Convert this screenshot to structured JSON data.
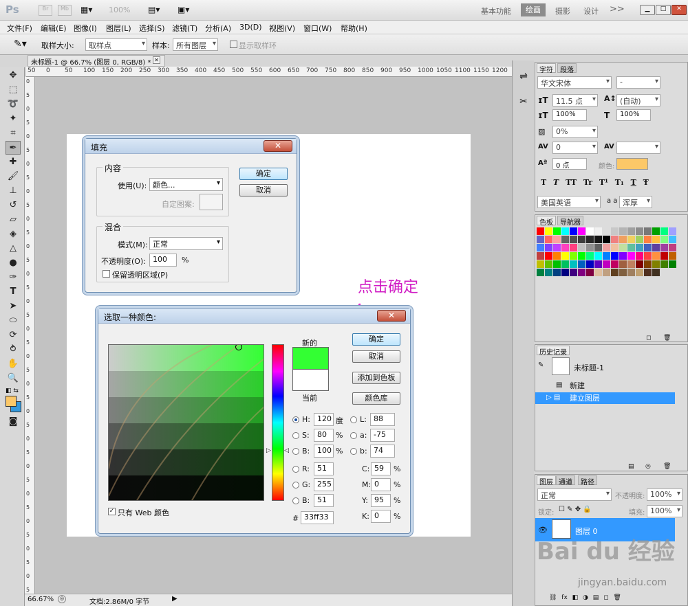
{
  "titlebar": {
    "app_logo": "Ps",
    "zoom": "100%",
    "workspaces": [
      "基本功能",
      "绘画",
      "摄影",
      "设计"
    ],
    "more": ">>",
    "win_min": "▁",
    "win_max": "□",
    "win_close": "✕"
  },
  "menu": [
    "文件(F)",
    "编辑(E)",
    "图像(I)",
    "图层(L)",
    "选择(S)",
    "滤镜(T)",
    "分析(A)",
    "3D(D)",
    "视图(V)",
    "窗口(W)",
    "帮助(H)"
  ],
  "options": {
    "sample_size_label": "取样大小:",
    "sample_size_value": "取样点",
    "sample_label": "样本:",
    "sample_value": "所有图层",
    "show_ring": "显示取样环"
  },
  "document": {
    "tab_title": "未标题-1 @ 66.7% (图层 0, RGB/8) *",
    "tab_close": "✕",
    "ruler_h": [
      "50",
      "0",
      "50",
      "100",
      "150",
      "200",
      "250",
      "300",
      "350",
      "400",
      "450",
      "500",
      "550",
      "600",
      "650",
      "700",
      "750",
      "800",
      "850",
      "900",
      "950",
      "1000",
      "1050",
      "1100",
      "1150",
      "1200"
    ],
    "ruler_v": [
      "0",
      "5",
      "0",
      "5",
      "0",
      "5",
      "0",
      "5",
      "0",
      "5",
      "0",
      "5",
      "0",
      "5",
      "0",
      "5",
      "0",
      "5",
      "0",
      "5",
      "0",
      "5",
      "0",
      "5",
      "0",
      "5",
      "0",
      "5",
      "0",
      "5",
      "0",
      "5",
      "0",
      "5",
      "0",
      "5",
      "0",
      "5"
    ]
  },
  "status": {
    "zoom": "66.67%",
    "doc_size": "文档:2.86M/0 字节"
  },
  "fill_dialog": {
    "title": "填充",
    "content_group": "内容",
    "use_label": "使用(U):",
    "use_value": "颜色...",
    "pattern_label": "自定图案:",
    "blend_group": "混合",
    "mode_label": "模式(M):",
    "mode_value": "正常",
    "opacity_label": "不透明度(O):",
    "opacity_value": "100",
    "opacity_unit": "%",
    "preserve_label": "保留透明区域(P)",
    "ok": "确定",
    "cancel": "取消"
  },
  "picker_dialog": {
    "title": "选取一种颜色:",
    "new_label": "新的",
    "current_label": "当前",
    "ok": "确定",
    "cancel": "取消",
    "add_swatch": "添加到色板",
    "libraries": "颜色库",
    "web_only": "只有 Web 颜色",
    "new_color": "#33ff33",
    "current_color": "#ffffff",
    "fields": {
      "H": "120",
      "H_unit": "度",
      "S": "80",
      "S_unit": "%",
      "B": "100",
      "B_unit": "%",
      "R": "51",
      "G": "255",
      "Bv": "51",
      "L": "88",
      "a": "-75",
      "b": "74",
      "C": "59",
      "M": "0",
      "Y": "95",
      "K": "0",
      "pct": "%",
      "hex": "33ff33",
      "hash": "#"
    },
    "labels": {
      "H": "H:",
      "S": "S:",
      "B": "B:",
      "R": "R:",
      "G": "G:",
      "Bv": "B:",
      "L": "L:",
      "a": "a:",
      "b": "b:",
      "C": "C:",
      "M": "M:",
      "Y": "Y:",
      "K": "K:"
    }
  },
  "annotation": "点击确定",
  "char_panel": {
    "tab1": "字符",
    "tab2": "段落",
    "font": "华文宋体",
    "style": "-",
    "size": "11.5 点",
    "leading": "(自动)",
    "vscale": "100%",
    "hscale": "100%",
    "tracking_pct": "0%",
    "kerning": "0",
    "baseline": "0 点",
    "color_label": "颜色:",
    "color": "#fcc868",
    "language": "美国英语",
    "aa_label": "a a",
    "aa_value": "浑厚",
    "styles": [
      "T",
      "T",
      "TT",
      "Tr",
      "T¹",
      "T₁",
      "T",
      "Ŧ"
    ]
  },
  "swatches_panel": {
    "tab1": "色板",
    "tab2": "导航器",
    "colors": [
      "#ff0000",
      "#ffff00",
      "#00ff00",
      "#00ffff",
      "#0000ff",
      "#ff00ff",
      "#ffffff",
      "#f0f0f0",
      "#dcdcdc",
      "#c8c8c8",
      "#b4b4b4",
      "#a0a0a0",
      "#8c8c8c",
      "#787878",
      "#00a000",
      "#00ff80",
      "#a0a0ff",
      "#6464c8",
      "#ff6464",
      "#ffa0a0",
      "#646464",
      "#505050",
      "#3c3c3c",
      "#282828",
      "#141414",
      "#000000",
      "#f08080",
      "#f0a060",
      "#f0d060",
      "#a0d060",
      "#ff8040",
      "#ffc040",
      "#80ff80",
      "#40c0ff",
      "#4080ff",
      "#8040ff",
      "#c040ff",
      "#ff40c0",
      "#ff4080",
      "#c0c0c0",
      "#909090",
      "#606060",
      "#f0a0a0",
      "#f0c0a0",
      "#c0e0a0",
      "#60c0a0",
      "#40a0c0",
      "#4060c0",
      "#6040a0",
      "#a040a0",
      "#c04080",
      "#c04040",
      "#ff0000",
      "#ff8000",
      "#ffff00",
      "#80ff00",
      "#00ff00",
      "#00ff80",
      "#00ffff",
      "#0080ff",
      "#0000ff",
      "#8000ff",
      "#ff00ff",
      "#ff0080",
      "#ff4040",
      "#ff9040",
      "#c00000",
      "#c06000",
      "#c0c000",
      "#60c000",
      "#00c000",
      "#00c060",
      "#00c0c0",
      "#0060c0",
      "#0000c0",
      "#6000c0",
      "#c000c0",
      "#c00060",
      "#a06040",
      "#c08060",
      "#800000",
      "#804000",
      "#808000",
      "#408000",
      "#008000",
      "#008040",
      "#008080",
      "#004080",
      "#000080",
      "#400080",
      "#800080",
      "#800040",
      "#e0c0a0",
      "#c0a080",
      "#604020",
      "#806040",
      "#a08060",
      "#c0a070",
      "#503020",
      "#403020"
    ]
  },
  "history_panel": {
    "tab": "历史记录",
    "snapshot": "未标题-1",
    "items": [
      "新建",
      "建立图层"
    ]
  },
  "layers_panel": {
    "tab1": "图层",
    "tab2": "通道",
    "tab3": "路径",
    "blend": "正常",
    "opacity_label": "不透明度:",
    "opacity": "100%",
    "lock_label": "锁定:",
    "fill_label": "填充:",
    "fill": "100%",
    "layer_name": "图层 0"
  },
  "watermark": {
    "brand": "Bai du 经验",
    "url": "jingyan.baidu.com"
  }
}
